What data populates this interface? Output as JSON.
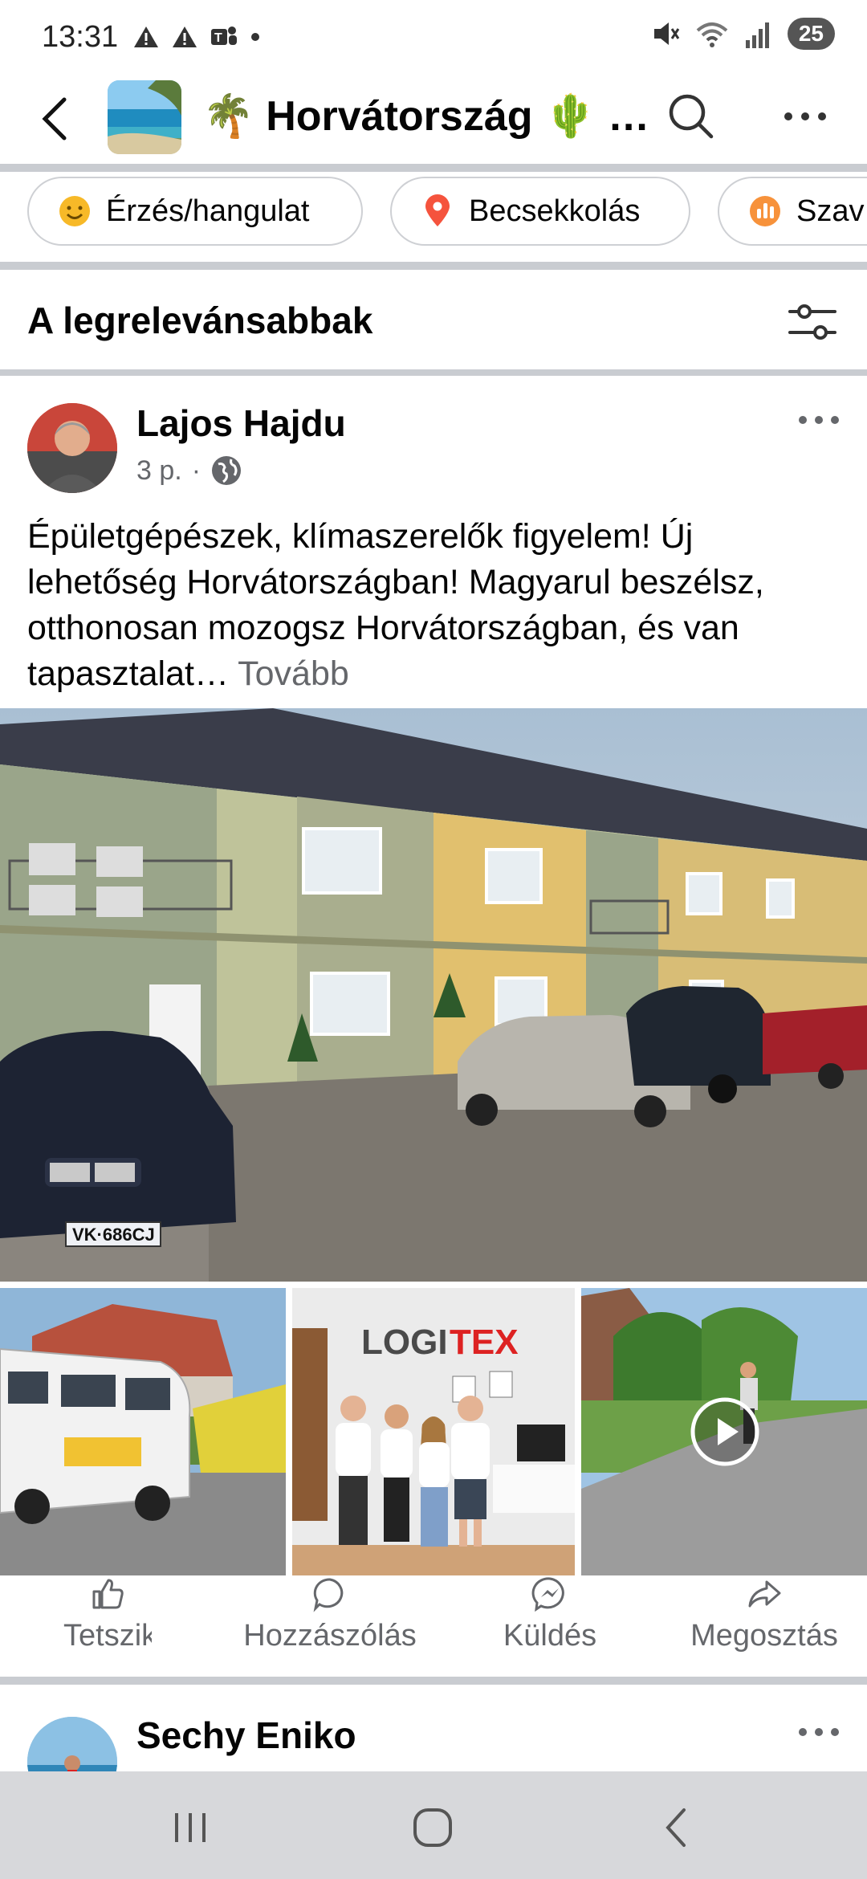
{
  "status_bar": {
    "time": "13:31",
    "battery": "25",
    "icons": [
      "alert-icon",
      "alert-icon",
      "teams-icon",
      "dot-icon",
      "mute-icon",
      "wifi-icon",
      "signal-icon"
    ]
  },
  "header": {
    "title": "🌴 Horvátország 🌵 …",
    "icons": [
      "back-arrow-icon",
      "search-icon",
      "more-icon"
    ]
  },
  "chips": [
    {
      "label": "Érzés/hangulat",
      "icon": "emoji-icon",
      "color": "#f7b928"
    },
    {
      "label": "Becsekkolás",
      "icon": "location-pin-icon",
      "color": "#f5533d"
    },
    {
      "label": "Szav",
      "icon": "poll-icon",
      "color": "#f7923b"
    }
  ],
  "sort": {
    "title": "A legrelevánsabbak",
    "icon": "filter-sliders-icon"
  },
  "post": {
    "author": "Lajos Hajdu",
    "time": "3 p.",
    "separator": "·",
    "privacy_icon": "globe-icon",
    "text": "Épületgépészek, klímaszerelők figyelem! Új lehetőség Horvátországban! Magyarul beszélsz, otthonosan mozogsz Horvátországban, és van tapasztalat…",
    "see_more": "Tovább",
    "photos": {
      "main": {
        "plate": "VK·686CJ"
      },
      "thumbs": [
        {
          "kind": "van-photo"
        },
        {
          "kind": "office-photo",
          "logo_text_a": "LOGI",
          "logo_text_b": "TEX"
        },
        {
          "kind": "video-thumbnail",
          "icon": "play-icon"
        }
      ]
    },
    "actions": [
      {
        "label": "Tetszik",
        "icon": "like-icon"
      },
      {
        "label": "Hozzászólás",
        "icon": "comment-icon"
      },
      {
        "label": "Küldés",
        "icon": "messenger-icon"
      },
      {
        "label": "Megosztás",
        "icon": "share-icon"
      }
    ]
  },
  "next_post": {
    "author": "Sechy Eniko"
  },
  "nav": {
    "icons": [
      "recent-apps-icon",
      "home-icon",
      "back-icon"
    ]
  },
  "colors": {
    "text": "#050505",
    "secondary": "#65676b",
    "divider": "#c9ccd1",
    "nav_bg": "#d7d8db"
  }
}
